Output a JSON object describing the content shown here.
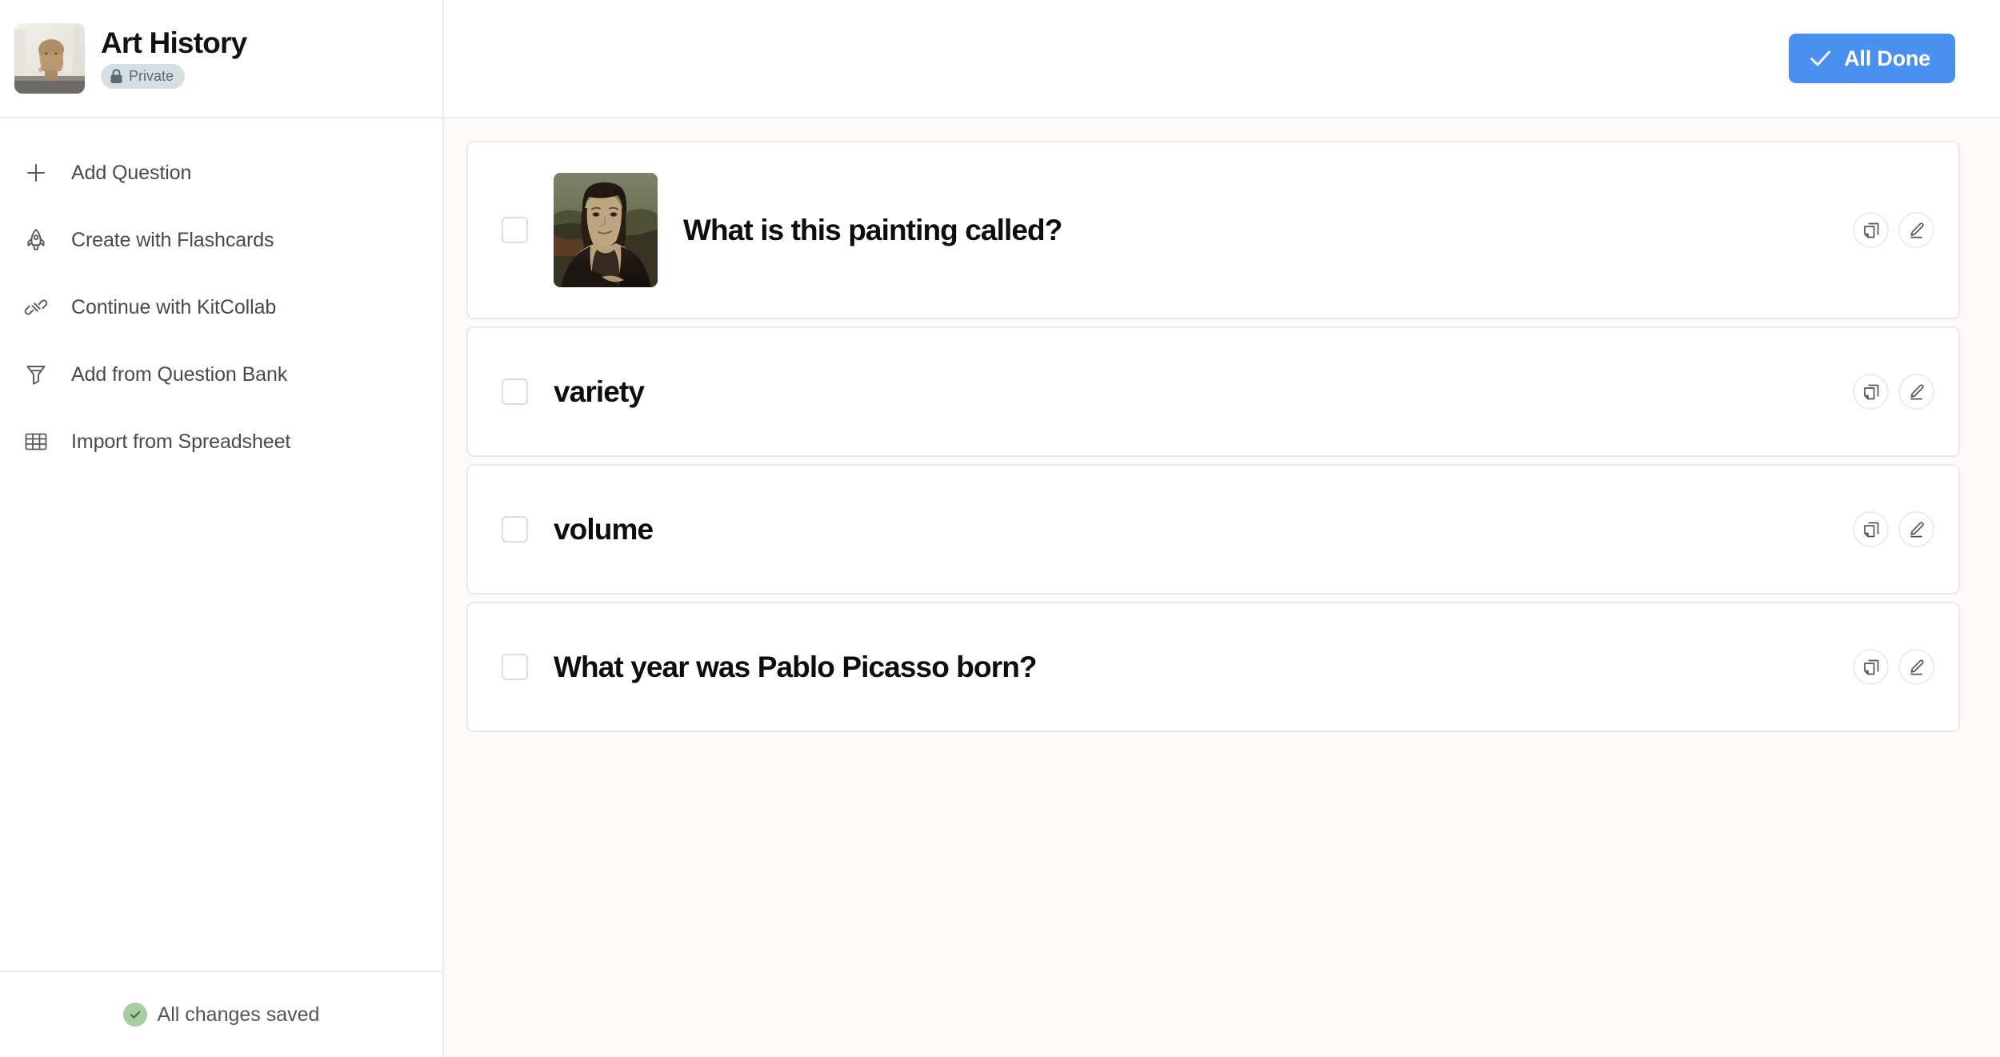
{
  "sidebar": {
    "kit": {
      "title": "Art History",
      "visibility_badge": "Private",
      "badge_icon": "lock-icon",
      "thumbnail_icon": "statue-thumbnail"
    },
    "nav_items": [
      {
        "label": "Add Question",
        "icon": "plus-icon"
      },
      {
        "label": "Create with Flashcards",
        "icon": "rocket-icon"
      },
      {
        "label": "Continue with KitCollab",
        "icon": "plug-connector-icon"
      },
      {
        "label": "Add from Question Bank",
        "icon": "funnel-icon"
      },
      {
        "label": "Import from Spreadsheet",
        "icon": "table-grid-icon"
      }
    ],
    "save_status": {
      "label": "All changes saved",
      "icon": "green-check-icon",
      "color": "#a9cca4"
    }
  },
  "topbar": {
    "all_done_label": "All Done",
    "all_done_icon": "check-icon",
    "all_done_color": "#4a90f0"
  },
  "questions": [
    {
      "text": "What is this painting called?",
      "has_image": true,
      "image_icon": "mona-lisa-thumbnail",
      "checked": false,
      "duplicate_icon": "duplicate-icon",
      "edit_icon": "pencil-icon"
    },
    {
      "text": "variety",
      "has_image": false,
      "checked": false,
      "duplicate_icon": "duplicate-icon",
      "edit_icon": "pencil-icon"
    },
    {
      "text": "volume",
      "has_image": false,
      "checked": false,
      "duplicate_icon": "duplicate-icon",
      "edit_icon": "pencil-icon"
    },
    {
      "text": "What year was Pablo Picasso born?",
      "has_image": false,
      "checked": false,
      "duplicate_icon": "duplicate-icon",
      "edit_icon": "pencil-icon"
    }
  ]
}
